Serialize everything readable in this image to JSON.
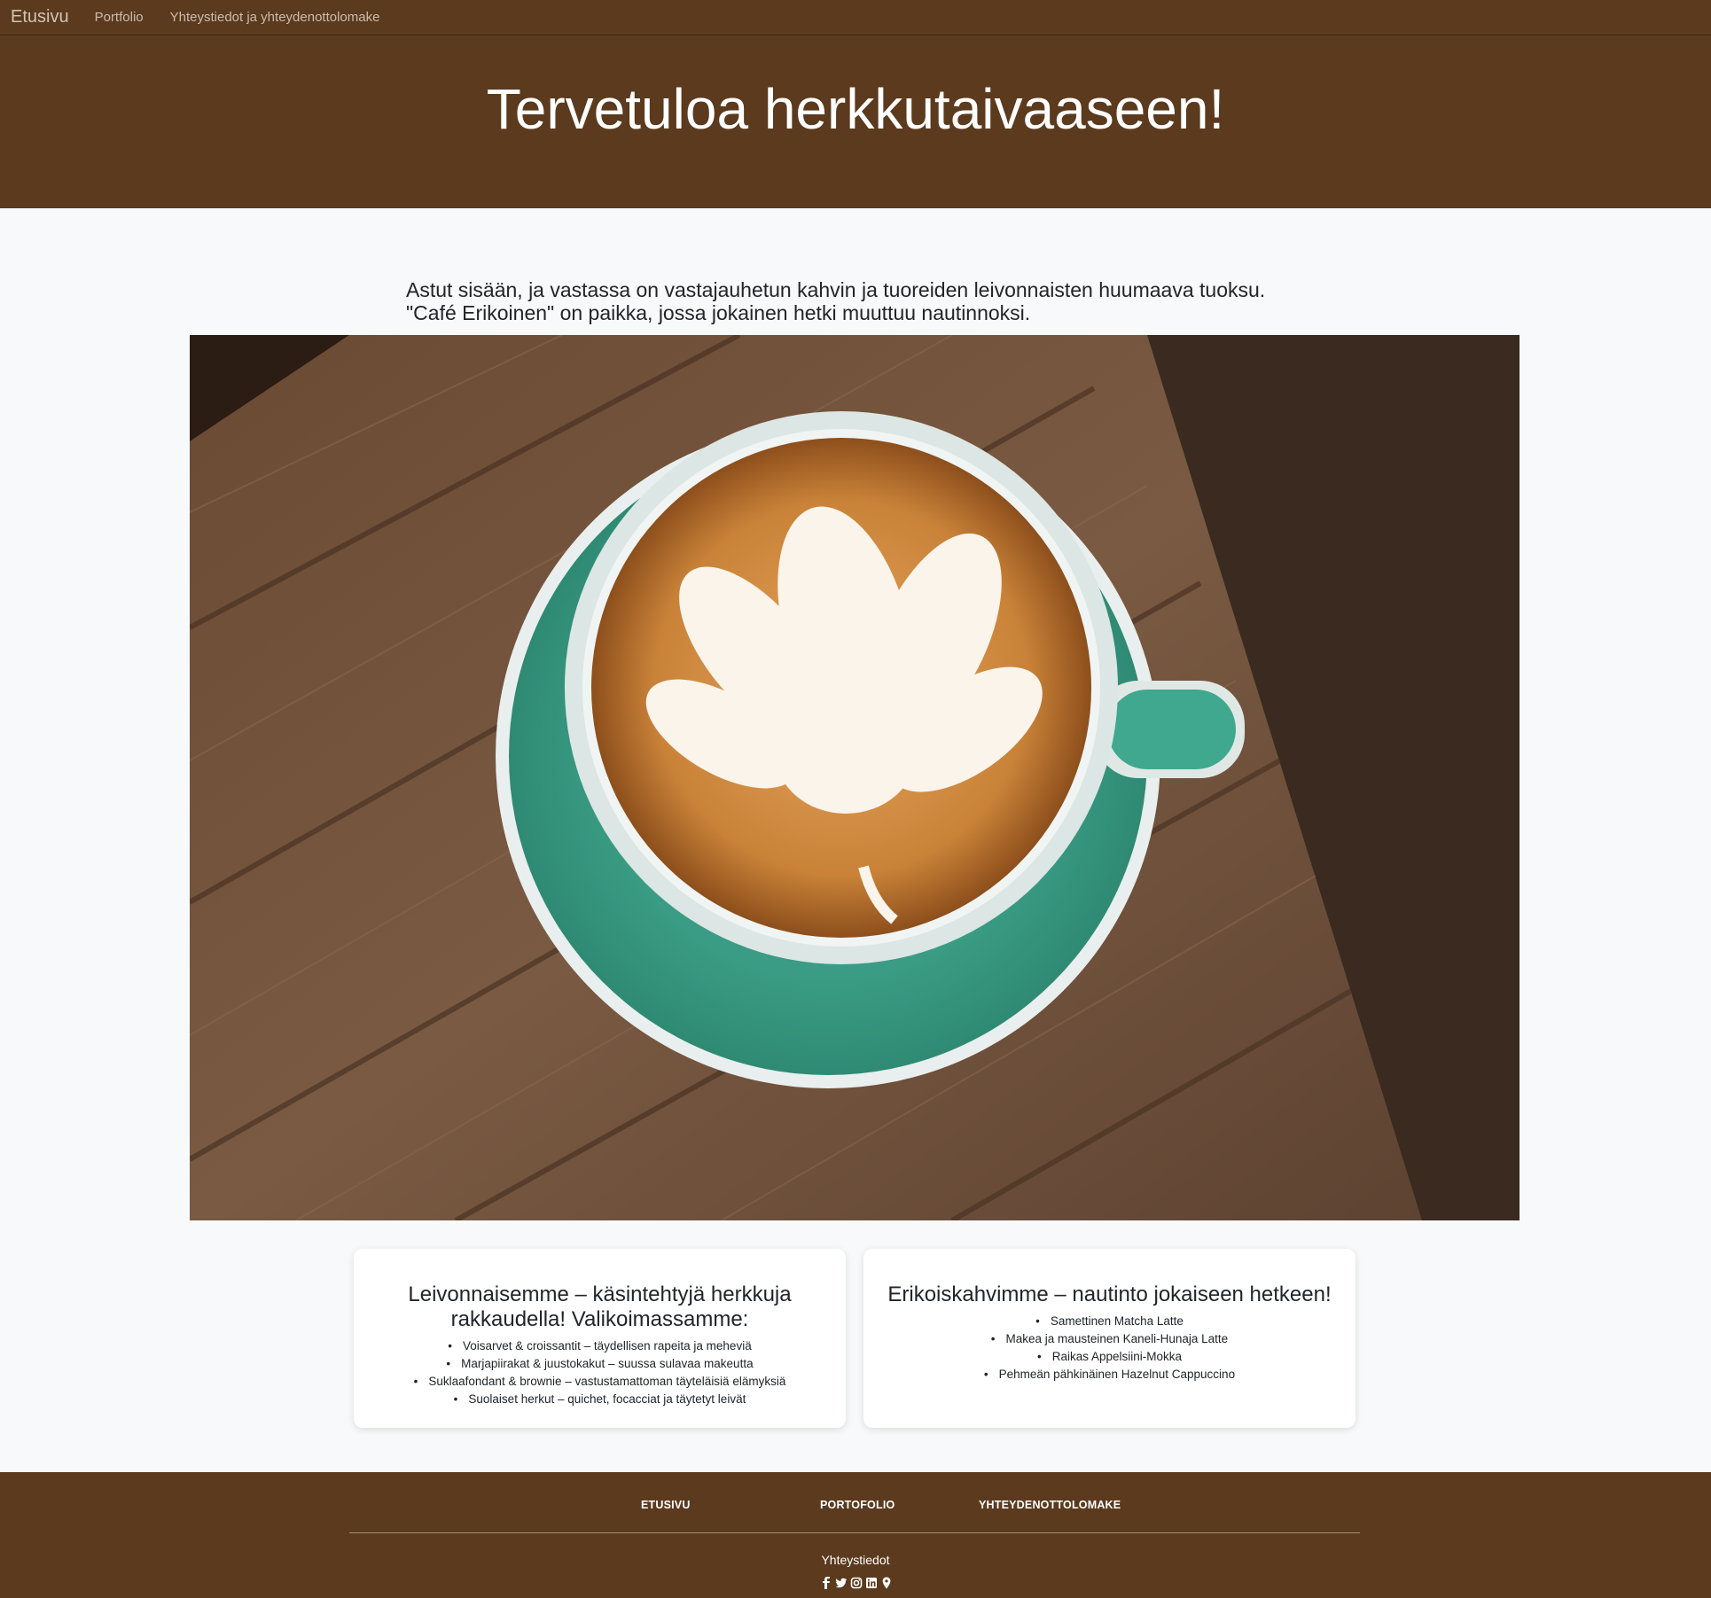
{
  "navbar": {
    "brand": "Etusivu",
    "links": [
      "Portfolio",
      "Yhteystiedot ja yhteydenottolomake"
    ]
  },
  "header": {
    "title": "Tervetuloa herkkutaivaaseen!"
  },
  "intro": {
    "line1": "Astut sisään, ja vastassa on vastajauhetun kahvin ja tuoreiden leivonnaisten huumaava tuoksu.",
    "line2": "\"Café Erikoinen\" on paikka, jossa jokainen hetki muuttuu nautinnoksi."
  },
  "hero_image": {
    "subject": "latte-art-cup-on-wooden-table"
  },
  "cards": [
    {
      "title": "Leivonnaisemme – käsintehtyjä herkkuja rakkaudella! Valikoimassamme:",
      "items": [
        "Voisarvet & croissantit – täydellisen rapeita ja meheviä",
        "Marjapiirakat & juustokakut – suussa sulavaa makeutta",
        "Suklaafondant & brownie – vastustamattoman täyteläisiä elämyksiä",
        "Suolaiset herkut – quichet, focacciat ja täytetyt leivät"
      ]
    },
    {
      "title": "Erikoiskahvimme – nautinto jokaiseen hetkeen!",
      "items": [
        "Samettinen Matcha Latte",
        "Makea ja mausteinen Kaneli-Hunaja Latte",
        "Raikas Appelsiini-Mokka",
        "Pehmeän pähkinäinen Hazelnut Cappuccino"
      ]
    }
  ],
  "footer": {
    "links": [
      "ETUSIVU",
      "PORTOFOLIO",
      "YHTEYDENOTTOLOMAKE"
    ],
    "contact": "Yhteystiedot",
    "social_icons": [
      "facebook-icon",
      "twitter-icon",
      "instagram-icon",
      "linkedin-icon",
      "map-marker-icon"
    ]
  },
  "colors": {
    "brand_brown": "#5b3a1e",
    "page_bg": "#f8f9fa",
    "cup_green": "#3aa58a"
  }
}
